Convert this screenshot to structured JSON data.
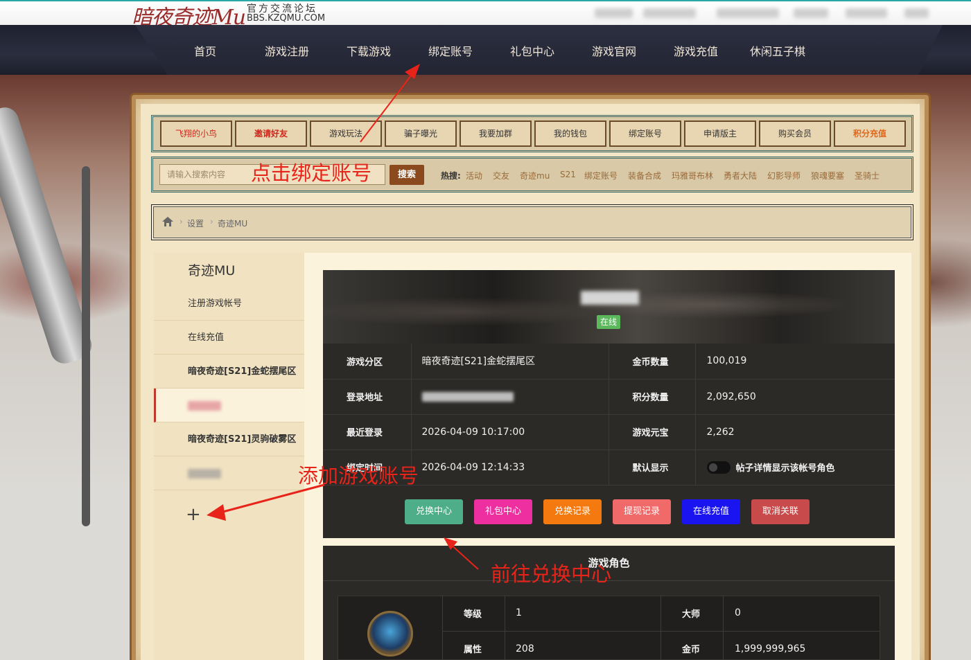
{
  "top": {
    "logo": "暗夜奇迹Mu",
    "forum_title": "官方交流论坛",
    "forum_url": "BBS.KZQMU.COM"
  },
  "nav": {
    "items": [
      "首页",
      "游戏注册",
      "下载游戏",
      "绑定账号",
      "礼包中心",
      "游戏官网",
      "游戏充值",
      "休闲五子棋"
    ]
  },
  "quick_links": [
    {
      "label": "飞翔的小鸟",
      "style": "red"
    },
    {
      "label": "邀请好友",
      "style": "redbold"
    },
    {
      "label": "游戏玩法",
      "style": "normal"
    },
    {
      "label": "骗子曝光",
      "style": "normal"
    },
    {
      "label": "我要加群",
      "style": "normal"
    },
    {
      "label": "我的钱包",
      "style": "normal"
    },
    {
      "label": "绑定账号",
      "style": "normal"
    },
    {
      "label": "申请版主",
      "style": "normal"
    },
    {
      "label": "购买会员",
      "style": "normal"
    },
    {
      "label": "积分充值",
      "style": "orange"
    }
  ],
  "search": {
    "placeholder": "请输入搜索内容",
    "button": "搜索",
    "hot_label": "热搜:",
    "hot_words": [
      "活动",
      "交友",
      "奇迹mu",
      "S21",
      "绑定账号",
      "装备合成",
      "玛雅哥布林",
      "勇者大陆",
      "幻影导师",
      "狼魂要塞",
      "圣骑士"
    ]
  },
  "breadcrumb": {
    "home_icon": "home-icon",
    "items": [
      "设置",
      "奇迹MU"
    ]
  },
  "side": {
    "title": "奇迹MU",
    "items": [
      {
        "label": "注册游戏帐号",
        "bold": false
      },
      {
        "label": "在线充值",
        "bold": false
      },
      {
        "label": "暗夜奇迹[S21]金蛇摆尾区",
        "bold": true
      },
      {
        "label": "",
        "bold": false
      },
      {
        "label": "暗夜奇迹[S21]灵驹破雾区",
        "bold": true
      },
      {
        "label": "",
        "bold": false
      }
    ],
    "add": "+"
  },
  "account": {
    "status": "在线",
    "rows": [
      {
        "l1": "游戏分区",
        "v1": "暗夜奇迹[S21]金蛇摆尾区",
        "l2": "金币数量",
        "v2": "100,019"
      },
      {
        "l1": "登录地址",
        "v1": "",
        "l2": "积分数量",
        "v2": "2,092,650"
      },
      {
        "l1": "最近登录",
        "v1": "2026-04-09 10:17:00",
        "l2": "游戏元宝",
        "v2": "2,262"
      },
      {
        "l1": "绑定时间",
        "v1": "2026-04-09 12:14:33",
        "l2": "默认显示",
        "v2": "帖子详情显示该帐号角色"
      }
    ],
    "buttons": [
      {
        "label": "兑换中心",
        "color": "#4fae8a"
      },
      {
        "label": "礼包中心",
        "color": "#ee2fa0"
      },
      {
        "label": "兑换记录",
        "color": "#f47a10"
      },
      {
        "label": "提现记录",
        "color": "#f06a6a"
      },
      {
        "label": "在线充值",
        "color": "#1a14f0"
      },
      {
        "label": "取消关联",
        "color": "#c94a4a"
      }
    ]
  },
  "character": {
    "title": "游戏角色",
    "rows": [
      {
        "l1": "等级",
        "v1": "1",
        "l2": "大师",
        "v2": "0"
      },
      {
        "l1": "属性",
        "v1": "208",
        "l2": "金币",
        "v2": "1,999,999,965"
      }
    ]
  },
  "annotations": {
    "bind": "点击绑定账号",
    "add": "添加游戏账号",
    "exchange": "前往兑换中心",
    "color": "#e8231a"
  }
}
